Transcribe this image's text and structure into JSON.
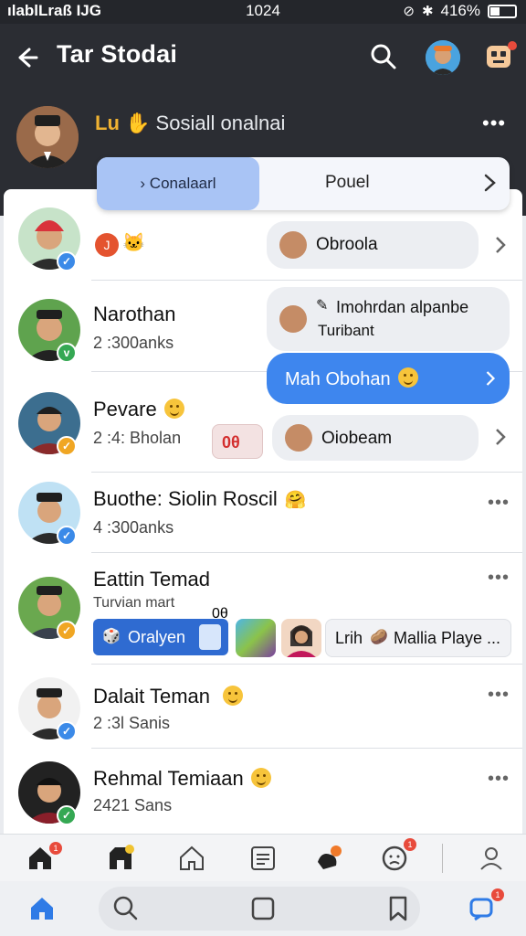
{
  "status_bar": {
    "carrier": "ılablLraß IJG",
    "time": "1024",
    "battery": "416%"
  },
  "header": {
    "title": "Tar Stodai",
    "profile_name_prefix": "Lu",
    "profile_name_rest": "Sosiall onalnai",
    "more": "•••"
  },
  "segment": {
    "active_label": "› Conalaarl",
    "inactive_label": "Pouel"
  },
  "rows": [
    {
      "name": "",
      "sub": "",
      "verify": "✓"
    },
    {
      "name": "Narothan",
      "sub": "2 :300anks",
      "verify": "v"
    },
    {
      "name": "Pevare",
      "sub": "2 :4: Bholan",
      "verify": "✓"
    },
    {
      "name": "Buothe: Siolin Roscil",
      "sub": "4 :300anks",
      "verify": "✓"
    },
    {
      "name": "Eattin Temad",
      "sub": "Turvian mart",
      "verify": "✓"
    },
    {
      "name": "Dalait Teman",
      "sub": "2 :3l Sanis",
      "verify": "✓"
    },
    {
      "name": "Rehmal Temiaan",
      "sub": "2421 Sans",
      "verify": "✓"
    }
  ],
  "bubbles": {
    "b1": "Obroola",
    "b2_line1": "Imohrdan alpanbe",
    "b2_line2": "Turibant",
    "b3": "Mah Obohan",
    "b4": "Oiobeam"
  },
  "badge_oo": "0θ",
  "row_more": "•••",
  "game_strip": {
    "pill": "Oralyen",
    "text": "Lrih",
    "text2": "Mallia Playe ..."
  },
  "tabbar_badges": {
    "b1": "1",
    "b2": "1",
    "b3": "1"
  },
  "colors": {
    "accent": "#3e86ee",
    "header_bg": "#2b2d33",
    "verified_blue": "#3b8ae8"
  }
}
